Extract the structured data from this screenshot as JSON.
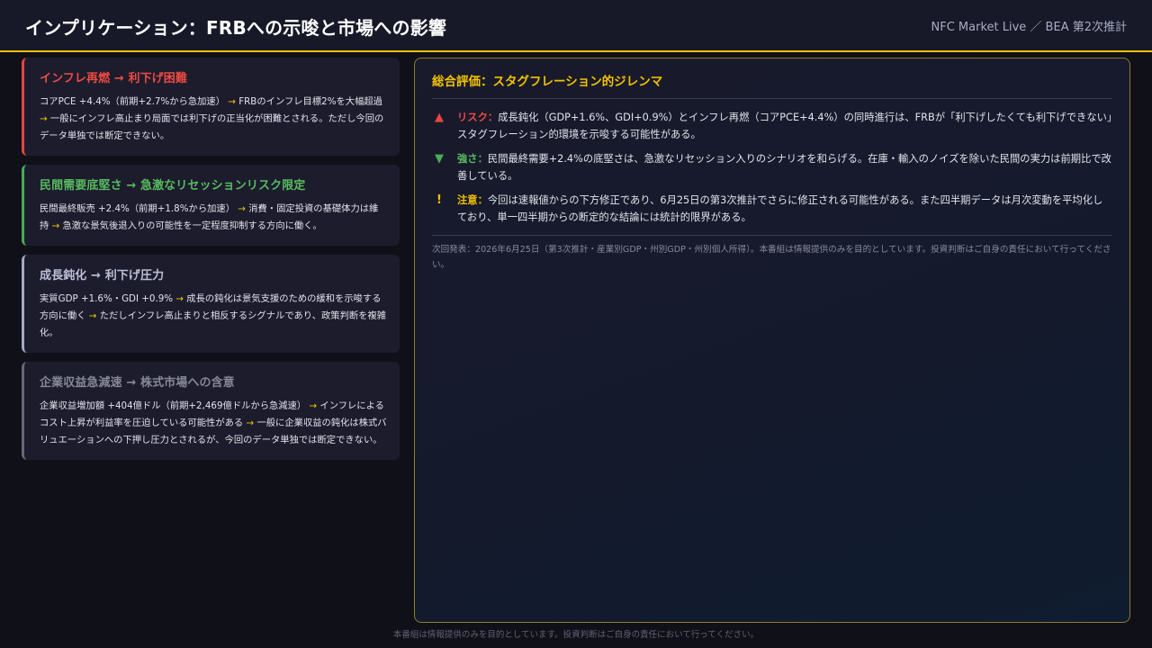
{
  "header": {
    "title": "インプリケーション：FRBへの示唆と市場への影響",
    "source": "NFC Market Live ／ BEA 第2次推計"
  },
  "colors": {
    "accent": "#f2c200",
    "red": "#ee4b43",
    "green": "#58bb5f",
    "violet": "#bcc0d6",
    "gray": "#868897"
  },
  "cards": [
    {
      "title_a": "インフレ再燃",
      "title_arrow": "→",
      "title_b": "利下げ困難",
      "p1": "コアPCE +4.4%（前期+2.7%から急加速）",
      "a1": "→",
      "p2": "FRBのインフレ目標2%を大幅超過",
      "a2": "→",
      "p3": "一般にインフレ高止まり局面では利下げの正当化が困難とされる。ただし今回のデータ単独では断定できない。"
    },
    {
      "title_a": "民間需要底堅さ",
      "title_arrow": "→",
      "title_b": "急激なリセッションリスク限定",
      "p1": "民間最終販売 +2.4%（前期+1.8%から加速）",
      "a1": "→",
      "p2": "消費・固定投資の基礎体力は維持",
      "a2": "→",
      "p3": "急激な景気後退入りの可能性を一定程度抑制する方向に働く。"
    },
    {
      "title_a": "成長鈍化",
      "title_arrow": "→",
      "title_b": "利下げ圧力",
      "p1": "実質GDP +1.6%・GDI +0.9%",
      "a1": "→",
      "p2": "成長の鈍化は景気支援のための緩和を示唆する方向に働く",
      "a2": "→",
      "p3": "ただしインフレ高止まりと相反するシグナルであり、政策判断を複雑化。"
    },
    {
      "title_a": "企業収益急減速",
      "title_arrow": "→",
      "title_b": "株式市場への含意",
      "p1": "企業収益増加額 +404億ドル（前期+2,469億ドルから急減速）",
      "a1": "→",
      "p2": "インフレによるコスト上昇が利益率を圧迫している可能性がある",
      "a2": "→",
      "p3": "一般に企業収益の鈍化は株式バリュエーションへの下押し圧力とされるが、今回のデータ単独では断定できない。"
    }
  ],
  "assessment": {
    "title": "総合評価：スタグフレーション的ジレンマ",
    "items": [
      {
        "icon": "▲",
        "icon_name": "triangle-up-icon",
        "label": "リスク：",
        "text": "成長鈍化（GDP+1.6%、GDI+0.9%）とインフレ再燃（コアPCE+4.4%）の同時進行は、FRBが「利下げしたくても利下げできない」スタグフレーション的環境を示唆する可能性がある。"
      },
      {
        "icon": "▼",
        "icon_name": "triangle-down-icon",
        "label": "強さ：",
        "text": "民間最終需要+2.4%の底堅さは、急激なリセッション入りのシナリオを和らげる。在庫・輸入のノイズを除いた民間の実力は前期比で改善している。"
      },
      {
        "icon": "!",
        "icon_name": "exclamation-icon",
        "label": "注意：",
        "text": "今回は速報値からの下方修正であり、6月25日の第3次推計でさらに修正される可能性がある。また四半期データは月次変動を平均化しており、単一四半期からの断定的な結論には統計的限界がある。"
      }
    ],
    "note": "次回発表：2026年6月25日（第3次推計・産業別GDP・州別GDP・州別個人所得）。本番組は情報提供のみを目的としています。投資判断はご自身の責任において行ってください。"
  },
  "footer": {
    "disclaimer": "本番組は情報提供のみを目的としています。投資判断はご自身の責任において行ってください。"
  }
}
